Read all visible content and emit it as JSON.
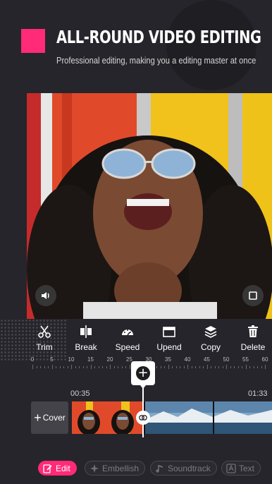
{
  "header": {
    "title": "ALL-ROUND VIDEO EDITING",
    "subtitle": "Professional editing, making you a editing master at once"
  },
  "toolbar": [
    {
      "label": "Trim",
      "icon": "scissors-icon"
    },
    {
      "label": "Break",
      "icon": "split-icon"
    },
    {
      "label": "Speed",
      "icon": "speedometer-icon"
    },
    {
      "label": "Upend",
      "icon": "upend-icon"
    },
    {
      "label": "Copy",
      "icon": "layers-icon"
    },
    {
      "label": "Delete",
      "icon": "trash-icon"
    }
  ],
  "ruler": {
    "marks": [
      "0",
      "5",
      "10",
      "15",
      "20",
      "25",
      "30",
      "35",
      "40",
      "45",
      "50",
      "55",
      "60"
    ]
  },
  "timeline": {
    "current_time": "00:35",
    "total_time": "01:33",
    "cover_label": "Cover",
    "add_clip": "+"
  },
  "tabs": [
    {
      "label": "Edit",
      "icon": "edit-icon",
      "active": true
    },
    {
      "label": "Embellish",
      "icon": "sparkle-icon",
      "active": false
    },
    {
      "label": "Soundtrack",
      "icon": "music-note-icon",
      "active": false
    },
    {
      "label": "Text",
      "icon": "text-icon",
      "active": false
    }
  ],
  "colors": {
    "accent": "#ff2a78",
    "background": "#26252b"
  }
}
